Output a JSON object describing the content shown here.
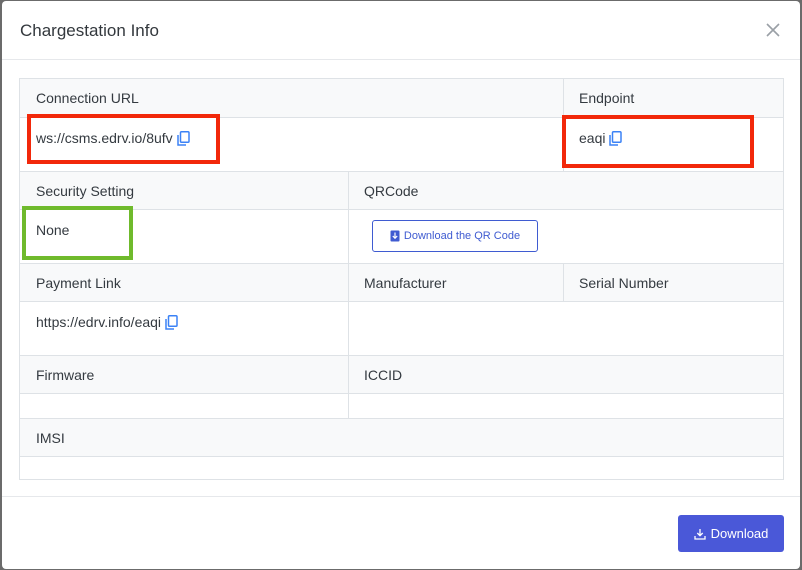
{
  "modal": {
    "title": "Chargestation Info"
  },
  "grid": {
    "connection_url": {
      "label": "Connection URL",
      "value": "ws://csms.edrv.io/8ufv"
    },
    "endpoint": {
      "label": "Endpoint",
      "value": "eaqi"
    },
    "security_setting": {
      "label": "Security Setting",
      "value": "None"
    },
    "qrcode": {
      "label": "QRCode",
      "button_label": "Download the QR Code"
    },
    "payment_link": {
      "label": "Payment Link",
      "value": "https://edrv.info/eaqi"
    },
    "manufacturer": {
      "label": "Manufacturer",
      "value": ""
    },
    "serial_number": {
      "label": "Serial Number",
      "value": ""
    },
    "firmware": {
      "label": "Firmware",
      "value": ""
    },
    "iccid": {
      "label": "ICCID",
      "value": ""
    },
    "imsi": {
      "label": "IMSI",
      "value": ""
    }
  },
  "footer": {
    "download_label": "Download"
  },
  "icons": {
    "close": "close-icon",
    "copy": "copy-icon",
    "download": "download-icon"
  },
  "colors": {
    "accent": "#4a58d8",
    "highlight_red": "#f2280a",
    "highlight_green": "#6fba2c"
  }
}
